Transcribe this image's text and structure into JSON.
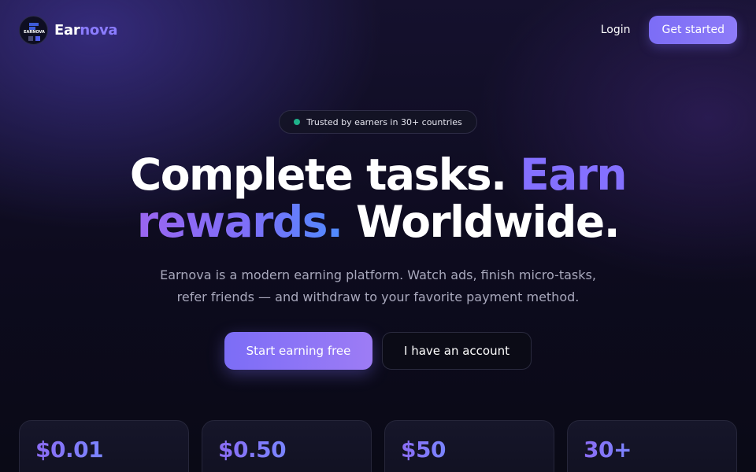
{
  "brand": {
    "name_part1": "Ear",
    "name_part2": "nova",
    "logo_text": "EARNOVA"
  },
  "nav": {
    "login_label": "Login",
    "get_started_label": "Get started"
  },
  "hero": {
    "badge_text": "Trusted by earners in 30+ countries",
    "headline": {
      "line1_white": "Complete tasks. ",
      "line1_accent": "Earn",
      "line2_accent": "rewards.",
      "line2_white": " Worldwide."
    },
    "subtitle_line1": "Earnova is a modern earning platform. Watch ads, finish micro-tasks,",
    "subtitle_line2": "refer friends — and withdraw to your favorite payment method.",
    "primary_cta": "Start earning free",
    "secondary_cta": "I have an account"
  },
  "stats": [
    {
      "value": "$0.01"
    },
    {
      "value": "$0.50"
    },
    {
      "value": "$50"
    },
    {
      "value": "30+"
    }
  ],
  "colors": {
    "accent": "#7c6df6",
    "status_dot": "#1fb28a",
    "background": "#0d0b1e"
  },
  "icons": {
    "logo": "earnova-logo-icon",
    "badge_dot": "status-dot-icon"
  }
}
